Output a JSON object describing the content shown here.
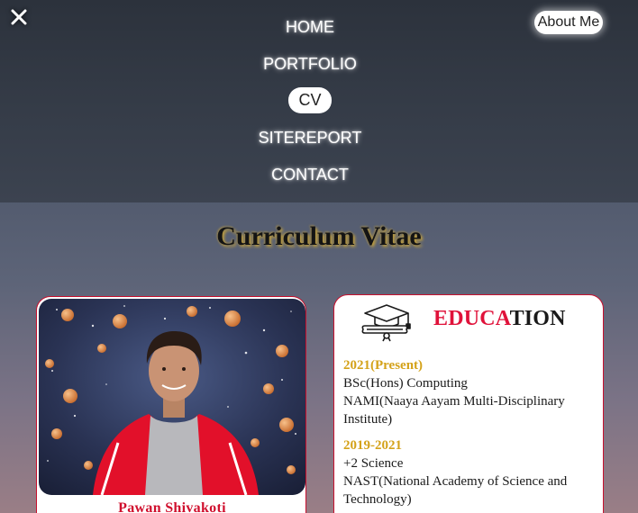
{
  "nav": {
    "close_icon": "close-x-icon",
    "about_label": "About Me",
    "items": [
      {
        "label": "HOME",
        "active": false
      },
      {
        "label": "PORTFOLIO",
        "active": false
      },
      {
        "label": "CV",
        "active": true
      },
      {
        "label": "SITEREPORT",
        "active": false
      },
      {
        "label": "CONTACT",
        "active": false
      }
    ]
  },
  "page_title": "Curriculum Vitae",
  "profile": {
    "name": "Pawan Shivakoti",
    "photo": "profile-photo"
  },
  "education": {
    "icon": "graduation-cap-diploma-icon",
    "heading_part1": "EDUCA",
    "heading_part2": "TION",
    "entries": [
      {
        "years": "2021(Present)",
        "course": "BSc(Hons) Computing",
        "institute": "NAMI(Naaya Aayam Multi-Disciplinary Institute)"
      },
      {
        "years": "2019-2021",
        "course": "+2 Science",
        "institute": "NAST(National Academy of Science and Technology)"
      }
    ]
  },
  "colors": {
    "accent_red": "#c8102e",
    "year_gold": "#d4a21a",
    "title_glow": "#c9a43a"
  }
}
